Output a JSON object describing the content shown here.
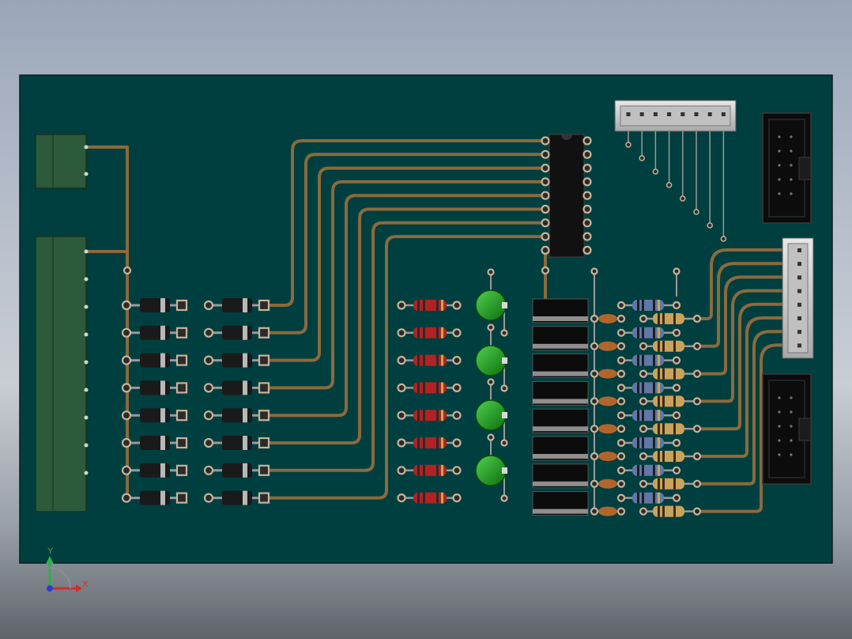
{
  "viewport": {
    "background_top": "#9aa6b8",
    "background_bottom": "#5f646b"
  },
  "pcb": {
    "board_color": "#003f3f",
    "trace_color": "#8b6a3d",
    "pad_color": "#c8b39a",
    "connector_color": "#2d5a3a",
    "ic_color": "#111111",
    "led_color": "#1fa51f",
    "rows": 8,
    "led_count": 4,
    "ic_pins_per_side": 9,
    "header_pins": 8
  },
  "triad": {
    "y_label": "Y",
    "x_label": "X",
    "y_color": "#2bb04a",
    "x_color": "#d62a2a",
    "z_color": "#2b3bd6"
  }
}
